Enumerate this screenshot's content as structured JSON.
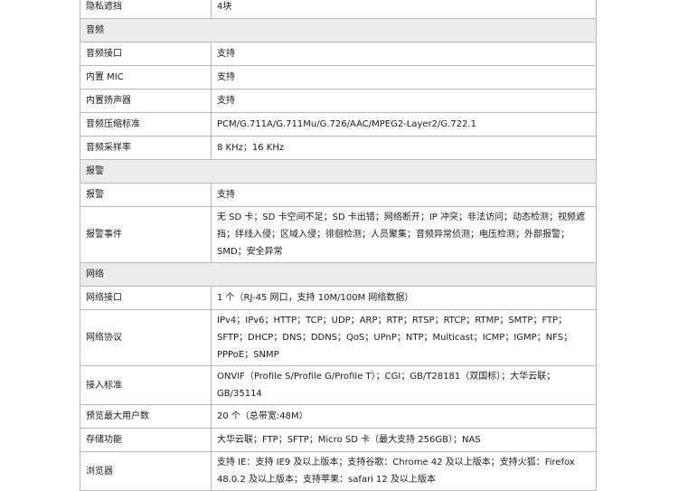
{
  "rows": [
    {
      "type": "row",
      "key": "隐私遮挡",
      "value": "4块"
    },
    {
      "type": "section",
      "title": "音频"
    },
    {
      "type": "row",
      "key": "音频接口",
      "value": "支持"
    },
    {
      "type": "row",
      "key": "内置 MIC",
      "value": "支持"
    },
    {
      "type": "row",
      "key": "内置扬声器",
      "value": "支持"
    },
    {
      "type": "row",
      "key": "音频压缩标准",
      "value": "PCM/G.711A/G.711Mu/G.726/AAC/MPEG2-Layer2/G.722.1"
    },
    {
      "type": "row",
      "key": "音频采样率",
      "value": "8 KHz；16 KHz"
    },
    {
      "type": "section",
      "title": "报警"
    },
    {
      "type": "row",
      "key": "报警",
      "value": "支持"
    },
    {
      "type": "row",
      "key": "报警事件",
      "value": "无 SD 卡；SD 卡空间不足；SD 卡出错；网络断开；IP 冲突；非法访问；动态检测；视频遮挡；绊线入侵；区域入侵；徘徊检测；人员聚集；音频异常侦测；电压检测；外部报警；SMD；安全异常"
    },
    {
      "type": "section",
      "title": "网络"
    },
    {
      "type": "row",
      "key": "网络接口",
      "value": "1 个（RJ-45 网口，支持 10M/100M 网络数据）"
    },
    {
      "type": "row",
      "key": "网络协议",
      "value": "IPv4；IPv6；HTTP；TCP；UDP；ARP；RTP；RTSP；RTCP；RTMP；SMTP；FTP；SFTP；DHCP；DNS；DDNS；QoS；UPnP；NTP；Multicast；ICMP；IGMP；NFS；PPPoE；SNMP"
    },
    {
      "type": "row",
      "key": "接入标准",
      "value": "ONVIF（Profile S/Profile G/Profile T）；CGI；GB/T28181（双国标）；大华云联；GB/35114"
    },
    {
      "type": "row",
      "key": "预览最大用户数",
      "value": "20 个（总带宽:48M）"
    },
    {
      "type": "row",
      "key": "存储功能",
      "value": "大华云联；FTP；SFTP；Micro SD 卡（最大支持 256GB）；NAS"
    },
    {
      "type": "row",
      "key": "浏览器",
      "value": "支持 IE：支持 IE9 及以上版本；支持谷歌：Chrome 42 及以上版本；支持火狐：Firefox 48.0.2 及以上版本；支持苹果：safari 12 及以上版本"
    }
  ]
}
